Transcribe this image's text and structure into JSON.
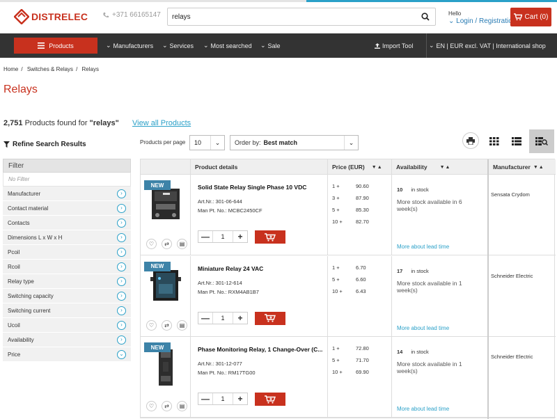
{
  "header": {
    "brand": "DISTRELEC",
    "phone": "+371 66165147",
    "search_value": "relays",
    "hello": "Hello",
    "login": "Login / Registration",
    "cart_label": "Cart (0)"
  },
  "nav": {
    "products": "Products",
    "items": [
      "Manufacturers",
      "Services",
      "Most searched",
      "Sale"
    ],
    "import_tool": "Import Tool",
    "locale": "EN | EUR excl. VAT | International shop"
  },
  "breadcrumb": [
    "Home",
    "Switches & Relays",
    "Relays"
  ],
  "page_title": "Relays",
  "results": {
    "count": "2,751",
    "text": "Products found for",
    "query": "\"relays\"",
    "view_all": "View all Products"
  },
  "refine": {
    "title": "Refine Search Results",
    "filter_header": "Filter",
    "no_filter": "No Filter",
    "facets": [
      "Manufacturer",
      "Contact material",
      "Contacts",
      "Dimensions L x W x H",
      "Pcoil",
      "Rcoil",
      "Relay type",
      "Switching capacity",
      "Switching current",
      "Ucoil",
      "Availability",
      "Price"
    ]
  },
  "controls": {
    "per_page_label": "Products per page",
    "per_page_value": "10",
    "order_label": "Order by:",
    "order_value": "Best match"
  },
  "table": {
    "headers": {
      "details": "Product details",
      "price": "Price (EUR)",
      "availability": "Availability",
      "manufacturer": "Manufacturer"
    },
    "products": [
      {
        "badge": "NEW",
        "name": "Solid State Relay Single Phase 10 VDC",
        "art_label": "Art.Nr.:",
        "art": "301-06-644",
        "man_label": "Man Pt. No.:",
        "man": "MCBC2450CF",
        "qty": "1",
        "prices": [
          {
            "q": "1 +",
            "v": "90.60"
          },
          {
            "q": "3 +",
            "v": "87.90"
          },
          {
            "q": "5 +",
            "v": "85.30"
          },
          {
            "q": "10 +",
            "v": "82.70"
          }
        ],
        "stock_count": "10",
        "stock_text": "in stock",
        "more_stock": "More stock available in 6 week(s)",
        "lead": "More about lead time",
        "manufacturer": "Sensata Crydom"
      },
      {
        "badge": "NEW",
        "name": "Miniature Relay 24 VAC",
        "art_label": "Art.Nr.:",
        "art": "301-12-614",
        "man_label": "Man Pt. No.:",
        "man": "RXM4AB1B7",
        "qty": "1",
        "prices": [
          {
            "q": "1 +",
            "v": "6.70"
          },
          {
            "q": "5 +",
            "v": "6.60"
          },
          {
            "q": "10 +",
            "v": "6.43"
          }
        ],
        "stock_count": "17",
        "stock_text": "in stock",
        "more_stock": "More stock available in 1 week(s)",
        "lead": "More about lead time",
        "manufacturer": "Schneider Electric"
      },
      {
        "badge": "NEW",
        "name": "Phase Monitoring Relay, 1 Change-Over (C...",
        "art_label": "Art.Nr.:",
        "art": "301-12-077",
        "man_label": "Man Pt. No.:",
        "man": "RM17TG00",
        "qty": "1",
        "prices": [
          {
            "q": "1 +",
            "v": "72.80"
          },
          {
            "q": "5 +",
            "v": "71.70"
          },
          {
            "q": "10 +",
            "v": "69.90"
          }
        ],
        "stock_count": "14",
        "stock_text": "in stock",
        "more_stock": "More stock available in 1 week(s)",
        "lead": "More about lead time",
        "manufacturer": "Schneider Electric"
      }
    ]
  },
  "colors": {
    "brand_red": "#c8311e",
    "link_blue": "#2aa0c8",
    "badge_blue": "#3d83a8",
    "nav_bg": "#333333"
  }
}
